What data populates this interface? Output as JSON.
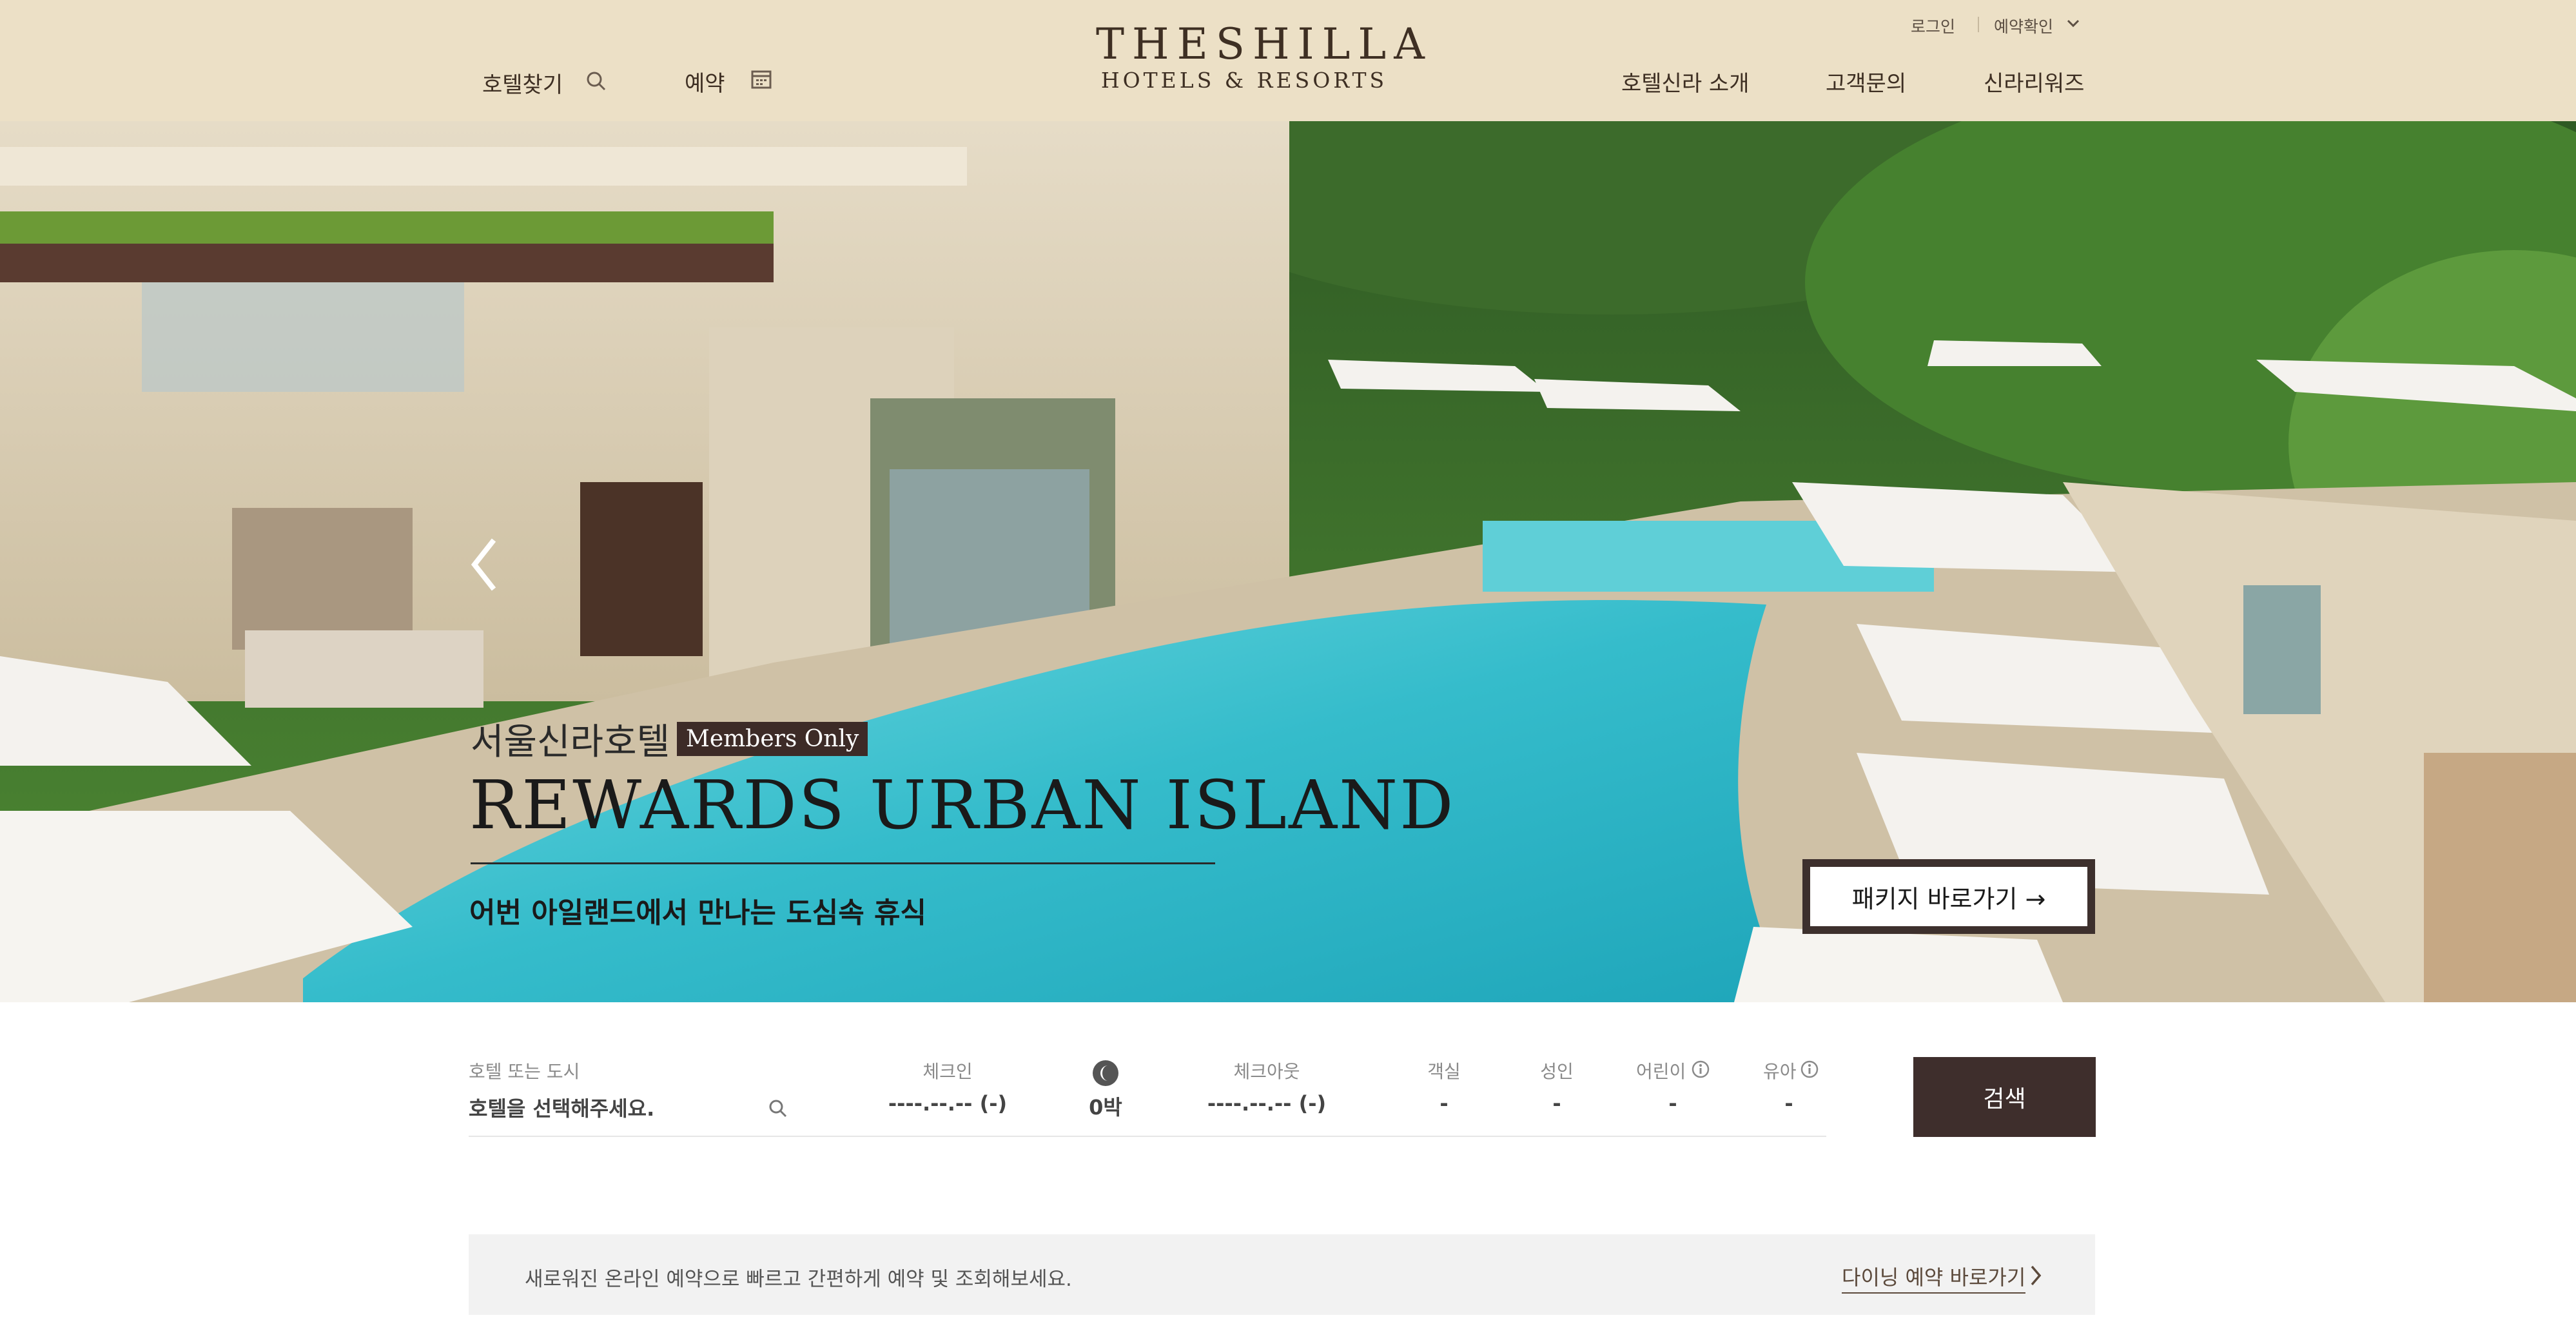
{
  "header": {
    "hotel_search_label": "호텔찾기",
    "reservation_label": "예약",
    "logo_main": "THESHILLA",
    "logo_sub": "HOTELS & RESORTS",
    "login_label": "로그인",
    "reservation_check_label": "예약확인",
    "nav_items": [
      "호텔신라 소개",
      "고객문의",
      "신라리워즈"
    ]
  },
  "hero": {
    "subtitle": "서울신라호텔",
    "badge": "Members Only",
    "title": "REWARDS URBAN ISLAND",
    "description": "어번 아일랜드에서 만나는 도심속 휴식",
    "package_button": "패키지 바로가기 →",
    "prev_arrow": "‹"
  },
  "search": {
    "hotel_label": "호텔 또는 도시",
    "hotel_placeholder": "호텔을 선택해주세요.",
    "checkin_label": "체크인",
    "checkin_value": "----.--.-- (-)",
    "nights_value": "0박",
    "checkout_label": "체크아웃",
    "checkout_value": "----.--.-- (-)",
    "rooms_label": "객실",
    "rooms_value": "-",
    "adults_label": "성인",
    "adults_value": "-",
    "children_label": "어린이",
    "children_value": "-",
    "infants_label": "유아",
    "infants_value": "-",
    "search_button": "검색"
  },
  "notice": {
    "text": "새로워진 온라인 예약으로 빠르고 간편하게 예약 및 조회해보세요.",
    "dining_link": "다이닝 예약 바로가기"
  },
  "colors": {
    "header_bg": "#ece0c6",
    "brand_dark": "#3e2e2c",
    "pool": "#3cc3d0"
  }
}
